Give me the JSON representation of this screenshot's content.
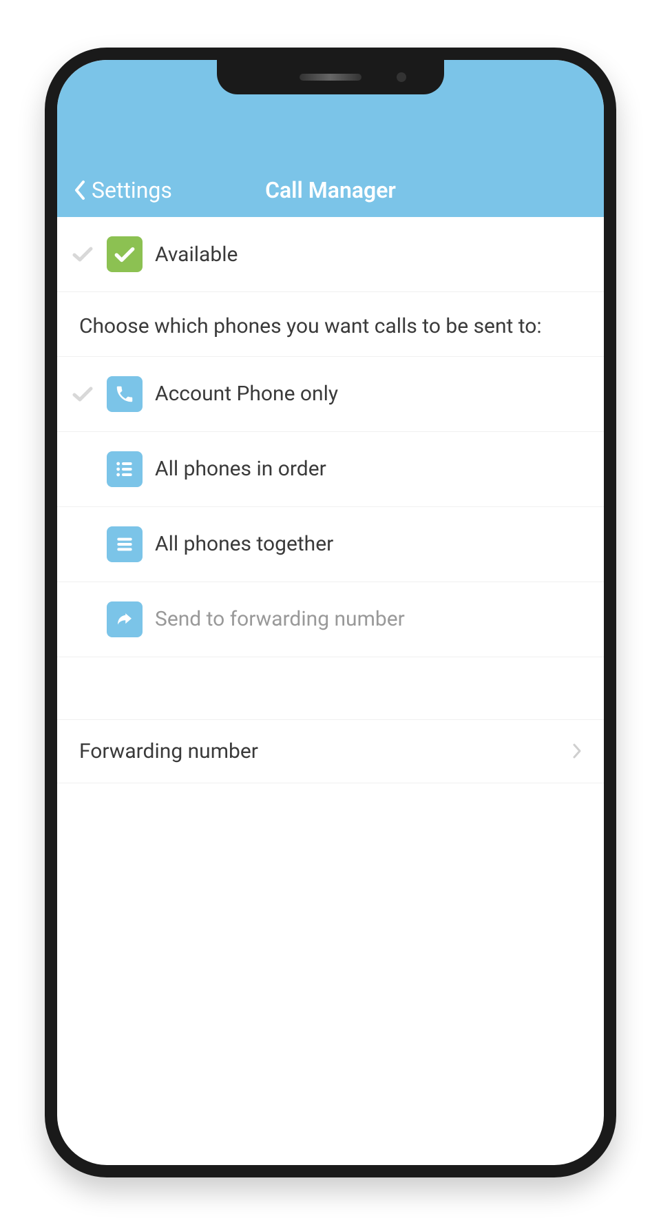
{
  "header": {
    "back_label": "Settings",
    "title": "Call Manager"
  },
  "status": {
    "label": "Available"
  },
  "instruction": "Choose which phones you want calls to be sent to:",
  "options": [
    {
      "label": "Account Phone only",
      "selected": true,
      "icon": "phone",
      "disabled": false
    },
    {
      "label": "All phones in order",
      "selected": false,
      "icon": "list-dots",
      "disabled": false
    },
    {
      "label": "All phones together",
      "selected": false,
      "icon": "list-lines",
      "disabled": false
    },
    {
      "label": "Send to forwarding number",
      "selected": false,
      "icon": "forward-arrow",
      "disabled": true
    }
  ],
  "forwarding": {
    "label": "Forwarding number"
  },
  "colors": {
    "header_bg": "#7bc4e8",
    "icon_blue": "#7bc4e8",
    "icon_green": "#8cc152",
    "text": "#3a3a3a",
    "text_disabled": "#999"
  }
}
